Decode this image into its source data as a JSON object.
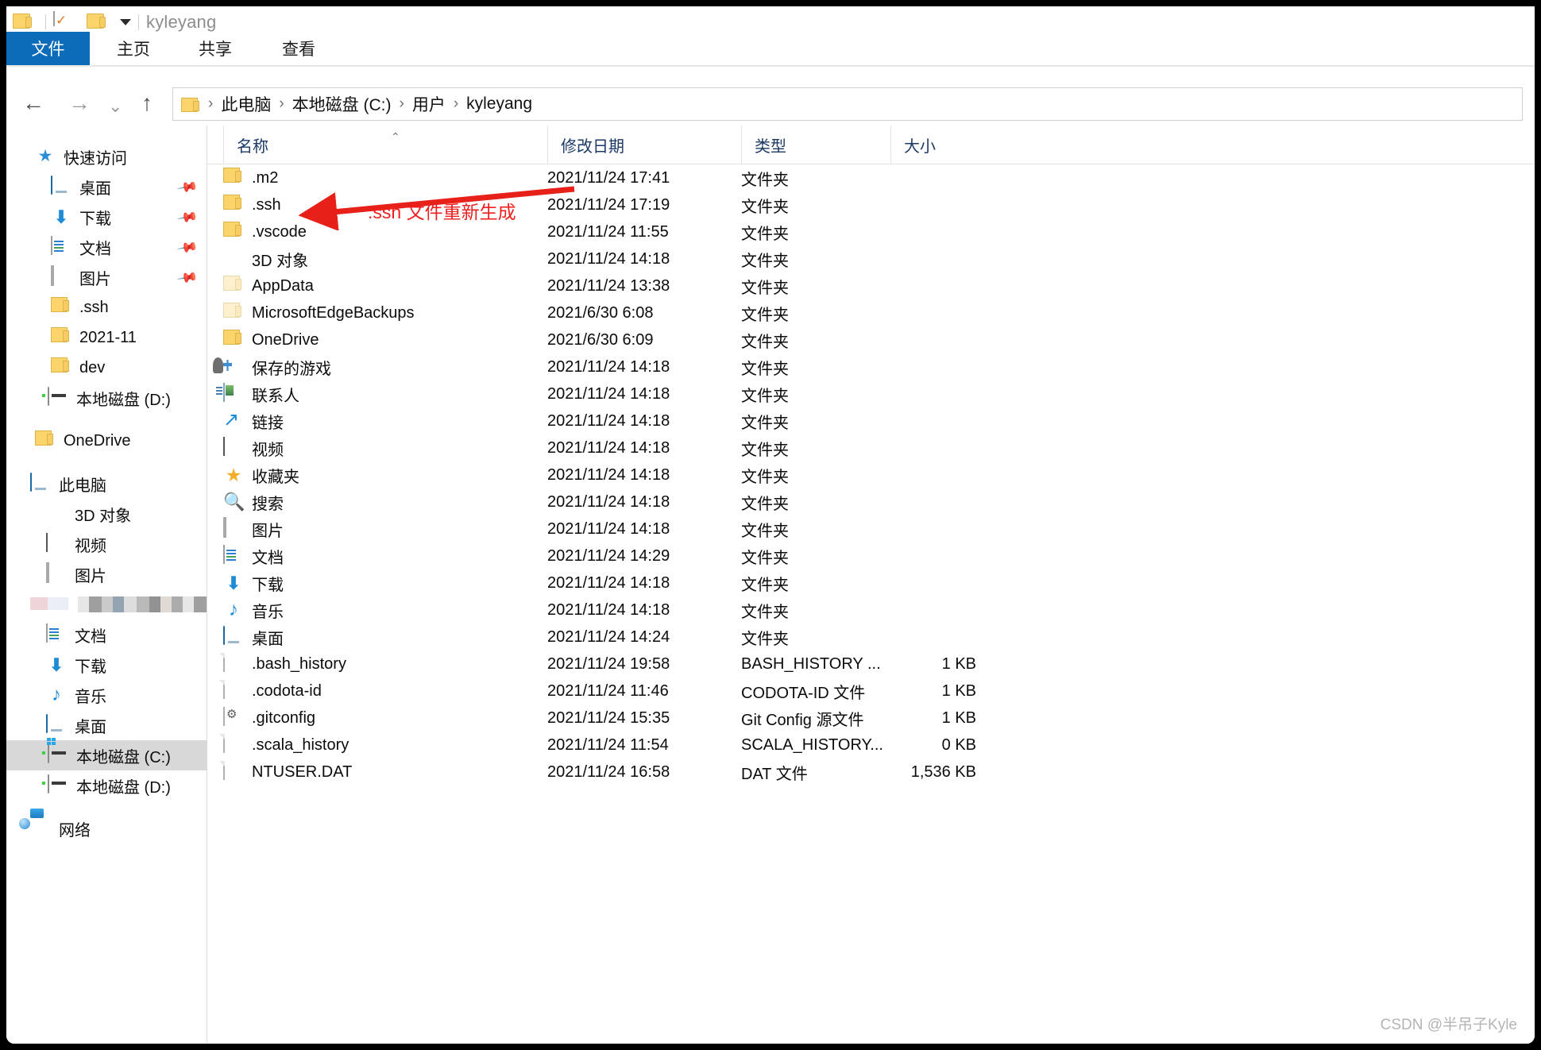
{
  "window": {
    "title": "kyleyang",
    "quick_access_icons": [
      "folder-icon",
      "properties-icon",
      "new-folder-icon",
      "customize-caret-icon"
    ]
  },
  "ribbon": {
    "tabs": [
      {
        "label": "文件",
        "active": true
      },
      {
        "label": "主页",
        "active": false
      },
      {
        "label": "共享",
        "active": false
      },
      {
        "label": "查看",
        "active": false
      }
    ]
  },
  "addressbar": {
    "back_icon": "arrow-left-icon",
    "forward_icon": "arrow-right-icon",
    "recent_icon": "chevron-down-icon",
    "up_icon": "arrow-up-icon",
    "breadcrumbs": [
      "此电脑",
      "本地磁盘 (C:)",
      "用户",
      "kyleyang"
    ],
    "separator": "›"
  },
  "sidebar": {
    "items": [
      {
        "label": "快速访问",
        "icon": "star-pin-icon",
        "indent": 0,
        "pinned": false,
        "selected": false
      },
      {
        "label": "桌面",
        "icon": "desktop-icon",
        "indent": 1,
        "pinned": true,
        "selected": false
      },
      {
        "label": "下载",
        "icon": "downloads-icon",
        "indent": 1,
        "pinned": true,
        "selected": false
      },
      {
        "label": "文档",
        "icon": "documents-icon",
        "indent": 1,
        "pinned": true,
        "selected": false
      },
      {
        "label": "图片",
        "icon": "pictures-icon",
        "indent": 1,
        "pinned": true,
        "selected": false
      },
      {
        "label": ".ssh",
        "icon": "folder-icon",
        "indent": 1,
        "pinned": false,
        "selected": false
      },
      {
        "label": "2021-11",
        "icon": "folder-icon",
        "indent": 1,
        "pinned": false,
        "selected": false
      },
      {
        "label": "dev",
        "icon": "folder-icon",
        "indent": 1,
        "pinned": false,
        "selected": false
      },
      {
        "label": "本地磁盘 (D:)",
        "icon": "drive-icon",
        "indent": 1,
        "pinned": false,
        "selected": false
      },
      {
        "label": "",
        "icon": "spacer",
        "indent": 0,
        "pinned": false,
        "selected": false
      },
      {
        "label": "OneDrive",
        "icon": "folder-icon",
        "indent": 0,
        "pinned": false,
        "selected": false
      },
      {
        "label": "",
        "icon": "spacer",
        "indent": 0,
        "pinned": false,
        "selected": false
      },
      {
        "label": "此电脑",
        "icon": "this-pc-icon",
        "indent": 0,
        "pinned": false,
        "selected": false
      },
      {
        "label": "3D 对象",
        "icon": "3d-objects-icon",
        "indent": 1,
        "pinned": false,
        "selected": false
      },
      {
        "label": "视频",
        "icon": "videos-icon",
        "indent": 1,
        "pinned": false,
        "selected": false
      },
      {
        "label": "图片",
        "icon": "pictures-icon",
        "indent": 1,
        "pinned": false,
        "selected": false
      },
      {
        "label": "",
        "icon": "redacted-icon",
        "indent": 1,
        "pinned": false,
        "selected": false
      },
      {
        "label": "文档",
        "icon": "documents-icon",
        "indent": 1,
        "pinned": false,
        "selected": false
      },
      {
        "label": "下载",
        "icon": "downloads-icon",
        "indent": 1,
        "pinned": false,
        "selected": false
      },
      {
        "label": "音乐",
        "icon": "music-icon",
        "indent": 1,
        "pinned": false,
        "selected": false
      },
      {
        "label": "桌面",
        "icon": "desktop-icon",
        "indent": 1,
        "pinned": false,
        "selected": false
      },
      {
        "label": "本地磁盘 (C:)",
        "icon": "system-drive-icon",
        "indent": 1,
        "pinned": false,
        "selected": true
      },
      {
        "label": "本地磁盘 (D:)",
        "icon": "drive-icon",
        "indent": 1,
        "pinned": false,
        "selected": false
      },
      {
        "label": "",
        "icon": "spacer",
        "indent": 0,
        "pinned": false,
        "selected": false
      },
      {
        "label": "网络",
        "icon": "network-icon",
        "indent": 0,
        "pinned": false,
        "selected": false
      }
    ]
  },
  "filelist": {
    "columns": [
      {
        "label": "名称",
        "sorted": true
      },
      {
        "label": "修改日期",
        "sorted": false
      },
      {
        "label": "类型",
        "sorted": false
      },
      {
        "label": "大小",
        "sorted": false
      }
    ],
    "sort_caret": "⌃",
    "rows": [
      {
        "name": ".m2",
        "date": "2021/11/24 17:41",
        "type": "文件夹",
        "size": "",
        "icon": "folder-icon"
      },
      {
        "name": ".ssh",
        "date": "2021/11/24 17:19",
        "type": "文件夹",
        "size": "",
        "icon": "folder-icon"
      },
      {
        "name": ".vscode",
        "date": "2021/11/24 11:55",
        "type": "文件夹",
        "size": "",
        "icon": "folder-icon"
      },
      {
        "name": "3D 对象",
        "date": "2021/11/24 14:18",
        "type": "文件夹",
        "size": "",
        "icon": "3d-objects-icon"
      },
      {
        "name": "AppData",
        "date": "2021/11/24 13:38",
        "type": "文件夹",
        "size": "",
        "icon": "folder-hidden-icon"
      },
      {
        "name": "MicrosoftEdgeBackups",
        "date": "2021/6/30 6:08",
        "type": "文件夹",
        "size": "",
        "icon": "folder-hidden-icon"
      },
      {
        "name": "OneDrive",
        "date": "2021/6/30 6:09",
        "type": "文件夹",
        "size": "",
        "icon": "folder-icon"
      },
      {
        "name": "保存的游戏",
        "date": "2021/11/24 14:18",
        "type": "文件夹",
        "size": "",
        "icon": "saved-games-icon"
      },
      {
        "name": "联系人",
        "date": "2021/11/24 14:18",
        "type": "文件夹",
        "size": "",
        "icon": "contacts-icon"
      },
      {
        "name": "链接",
        "date": "2021/11/24 14:18",
        "type": "文件夹",
        "size": "",
        "icon": "links-icon"
      },
      {
        "name": "视频",
        "date": "2021/11/24 14:18",
        "type": "文件夹",
        "size": "",
        "icon": "videos-icon"
      },
      {
        "name": "收藏夹",
        "date": "2021/11/24 14:18",
        "type": "文件夹",
        "size": "",
        "icon": "favorites-icon"
      },
      {
        "name": "搜索",
        "date": "2021/11/24 14:18",
        "type": "文件夹",
        "size": "",
        "icon": "searches-icon"
      },
      {
        "name": "图片",
        "date": "2021/11/24 14:18",
        "type": "文件夹",
        "size": "",
        "icon": "pictures-icon"
      },
      {
        "name": "文档",
        "date": "2021/11/24 14:29",
        "type": "文件夹",
        "size": "",
        "icon": "documents-icon"
      },
      {
        "name": "下载",
        "date": "2021/11/24 14:18",
        "type": "文件夹",
        "size": "",
        "icon": "downloads-icon"
      },
      {
        "name": "音乐",
        "date": "2021/11/24 14:18",
        "type": "文件夹",
        "size": "",
        "icon": "music-icon"
      },
      {
        "name": "桌面",
        "date": "2021/11/24 14:24",
        "type": "文件夹",
        "size": "",
        "icon": "desktop-icon"
      },
      {
        "name": ".bash_history",
        "date": "2021/11/24 19:58",
        "type": "BASH_HISTORY ...",
        "size": "1 KB",
        "icon": "generic-file-icon"
      },
      {
        "name": ".codota-id",
        "date": "2021/11/24 11:46",
        "type": "CODOTA-ID 文件",
        "size": "1 KB",
        "icon": "generic-file-icon"
      },
      {
        "name": ".gitconfig",
        "date": "2021/11/24 15:35",
        "type": "Git Config 源文件",
        "size": "1 KB",
        "icon": "gitconfig-file-icon"
      },
      {
        "name": ".scala_history",
        "date": "2021/11/24 11:54",
        "type": "SCALA_HISTORY...",
        "size": "0 KB",
        "icon": "generic-file-icon"
      },
      {
        "name": "NTUSER.DAT",
        "date": "2021/11/24 16:58",
        "type": "DAT 文件",
        "size": "1,536 KB",
        "icon": "generic-file-icon"
      }
    ]
  },
  "annotation": {
    "text": ".ssh 文件重新生成",
    "color": "#ef1f1f",
    "arrow": "red-arrow-left-icon"
  },
  "watermark": {
    "text": "CSDN @半吊子Kyle"
  },
  "colors": {
    "accent": "#0d6cb9",
    "selection": "#d8d8d8",
    "header_text": "#1b3a66",
    "annotation": "#ef1f1f"
  }
}
